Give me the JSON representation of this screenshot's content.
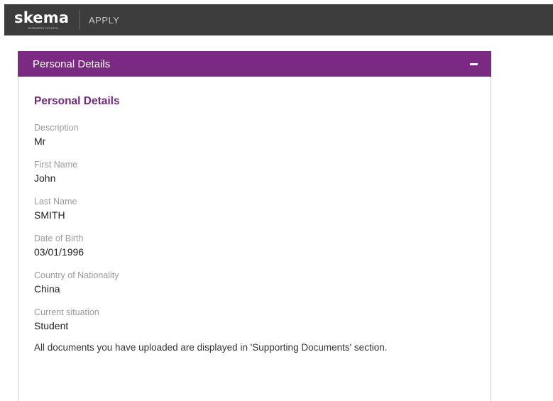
{
  "header": {
    "logo_text": "skema",
    "logo_subtext": "BUSINESS SCHOOL",
    "nav_link": "APPLY"
  },
  "panel": {
    "title": "Personal Details",
    "collapse_icon": "minus-icon",
    "accent_color": "#7a2a82",
    "section_heading": "Personal Details",
    "fields": [
      {
        "label": "Description",
        "value": "Mr"
      },
      {
        "label": "First Name",
        "value": "John"
      },
      {
        "label": "Last Name",
        "value": "SMITH"
      },
      {
        "label": "Date of Birth",
        "value": "03/01/1996"
      },
      {
        "label": "Country of Nationality",
        "value": "China"
      },
      {
        "label": "Current situation",
        "value": "Student"
      }
    ],
    "note": "All documents you have uploaded are displayed in 'Supporting Documents' section."
  }
}
